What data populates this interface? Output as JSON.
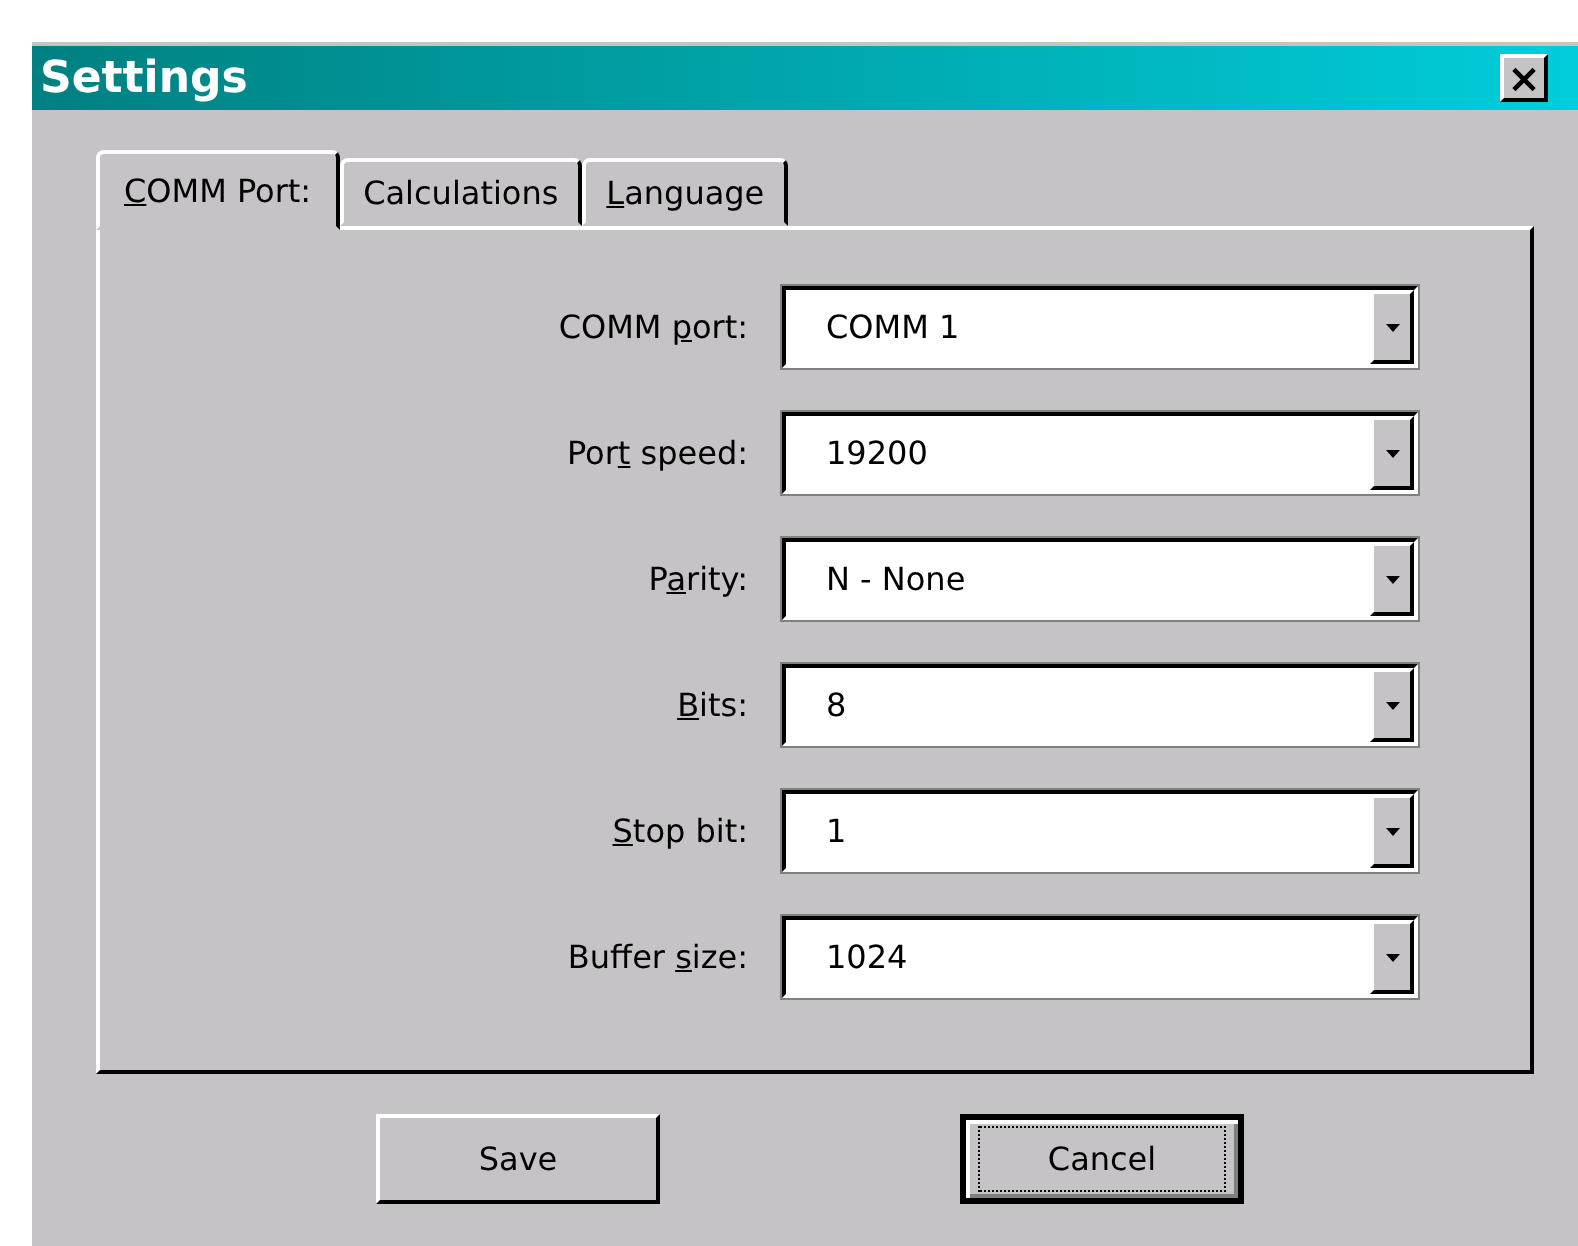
{
  "window": {
    "title": "Settings",
    "close": "×"
  },
  "tabs": [
    {
      "label": {
        "key": "C",
        "after": "OMM Port:"
      },
      "selected": true
    },
    {
      "label": {
        "before": "Calculations"
      },
      "selected": false
    },
    {
      "label": {
        "key": "L",
        "after": "anguage"
      },
      "selected": false
    }
  ],
  "fields": [
    {
      "label": {
        "before": "COMM ",
        "key": "p",
        "after": "ort:"
      },
      "value": "COMM 1"
    },
    {
      "label": {
        "before": "Por",
        "key": "t",
        "after": " speed:"
      },
      "value": "19200"
    },
    {
      "label": {
        "before": "P",
        "key": "a",
        "after": "rity:"
      },
      "value": "N - None"
    },
    {
      "label": {
        "key": "B",
        "after": "its:"
      },
      "value": "8"
    },
    {
      "label": {
        "key": "S",
        "after": "top bit:"
      },
      "value": "1"
    },
    {
      "label": {
        "before": "Buffer ",
        "key": "s",
        "after": "ize:"
      },
      "value": "1024"
    }
  ],
  "buttons": [
    {
      "label": "Save",
      "focused": false
    },
    {
      "label": "Cancel",
      "focused": true
    }
  ]
}
